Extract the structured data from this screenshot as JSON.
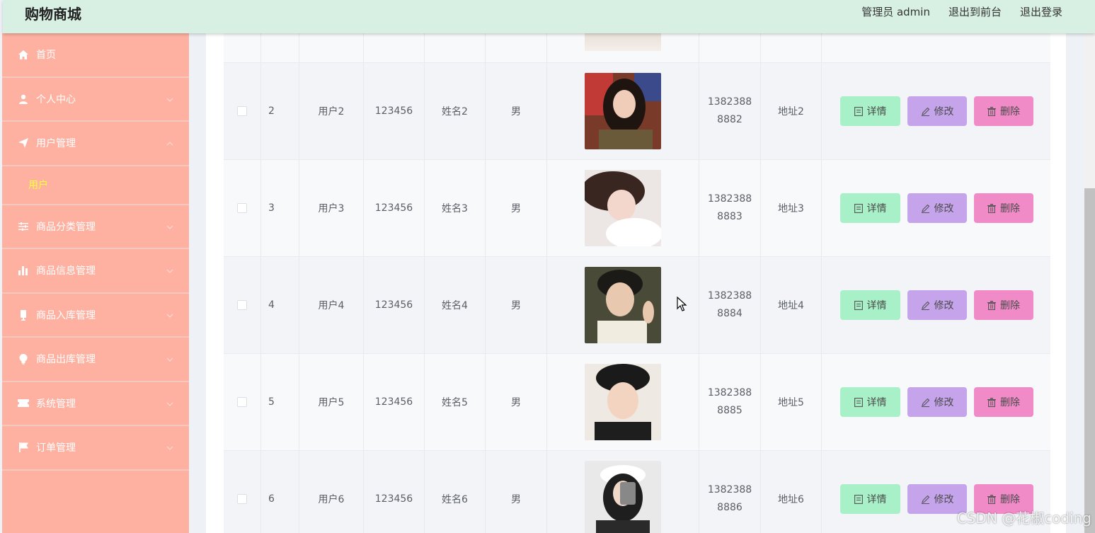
{
  "header": {
    "brand": "购物商城",
    "admin_label": "管理员 admin",
    "front_link": "退出到前台",
    "logout_link": "退出登录"
  },
  "sidebar": {
    "items": [
      {
        "label": "首页",
        "icon": "home-icon"
      },
      {
        "label": "个人中心",
        "icon": "user-icon"
      },
      {
        "label": "用户管理",
        "icon": "send-icon"
      },
      {
        "label": "商品分类管理",
        "icon": "sliders-icon"
      },
      {
        "label": "商品信息管理",
        "icon": "bar-chart-icon"
      },
      {
        "label": "商品入库管理",
        "icon": "battery-icon"
      },
      {
        "label": "商品出库管理",
        "icon": "bulb-icon"
      },
      {
        "label": "系统管理",
        "icon": "ticket-icon"
      },
      {
        "label": "订单管理",
        "icon": "flag-icon"
      }
    ],
    "submenu": {
      "label": "用户"
    }
  },
  "table": {
    "rows": [
      {
        "index": "2",
        "username": "用户2",
        "password": "123456",
        "name": "姓名2",
        "gender": "男",
        "phone_line1": "1382388",
        "phone_line2": "8882",
        "address": "地址2",
        "avatar": "female-avatar-long-hair"
      },
      {
        "index": "3",
        "username": "用户3",
        "password": "123456",
        "name": "姓名3",
        "gender": "男",
        "phone_line1": "1382388",
        "phone_line2": "8883",
        "address": "地址3",
        "avatar": "female-avatar-lying"
      },
      {
        "index": "4",
        "username": "用户4",
        "password": "123456",
        "name": "姓名4",
        "gender": "男",
        "phone_line1": "1382388",
        "phone_line2": "8884",
        "address": "地址4",
        "avatar": "male-avatar-peace-sign"
      },
      {
        "index": "5",
        "username": "用户5",
        "password": "123456",
        "name": "姓名5",
        "gender": "男",
        "phone_line1": "1382388",
        "phone_line2": "8885",
        "address": "地址5",
        "avatar": "male-avatar-cap"
      },
      {
        "index": "6",
        "username": "用户6",
        "password": "123456",
        "name": "姓名6",
        "gender": "男",
        "phone_line1": "1382388",
        "phone_line2": "8886",
        "address": "地址6",
        "avatar": "female-avatar-selfie"
      }
    ],
    "actions": {
      "detail": "详情",
      "edit": "修改",
      "delete": "删除"
    }
  },
  "colors": {
    "header_bg": "#d8f0e4",
    "sidebar_bg": "#ffb1a1",
    "submenu_active": "#ffff3b",
    "detail_btn": "#a8f0c8",
    "edit_btn": "#c5a4ec",
    "delete_btn": "#f08bc8"
  },
  "watermark": "CSDN @花椒coding"
}
